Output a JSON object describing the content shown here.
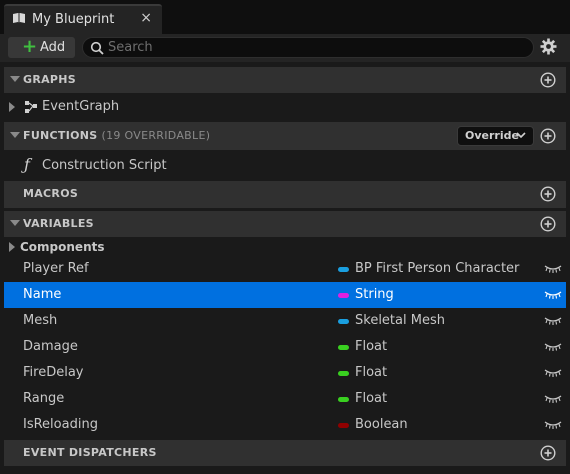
{
  "tab": {
    "title": "My Blueprint",
    "close": "×"
  },
  "toolbar": {
    "add_label": "Add",
    "search_placeholder": "Search"
  },
  "graphs": {
    "title": "GRAPHS",
    "items": [
      {
        "label": "EventGraph"
      }
    ]
  },
  "functions": {
    "title": "FUNCTIONS",
    "subtitle": "(19 OVERRIDABLE)",
    "override_label": "Override",
    "items": [
      {
        "label": "Construction Script"
      }
    ]
  },
  "macros": {
    "title": "MACROS"
  },
  "variables": {
    "title": "VARIABLES",
    "category": "Components",
    "items": [
      {
        "name": "Player Ref",
        "type": "BP First Person Character",
        "color": "#1a9fe0",
        "selected": false
      },
      {
        "name": "Name",
        "type": "String",
        "color": "#e020e0",
        "selected": true
      },
      {
        "name": "Mesh",
        "type": "Skeletal Mesh",
        "color": "#1a9fe0",
        "selected": false
      },
      {
        "name": "Damage",
        "type": "Float",
        "color": "#39d020",
        "selected": false
      },
      {
        "name": "FireDelay",
        "type": "Float",
        "color": "#39d020",
        "selected": false
      },
      {
        "name": "Range",
        "type": "Float",
        "color": "#39d020",
        "selected": false
      },
      {
        "name": "IsReloading",
        "type": "Boolean",
        "color": "#900000",
        "selected": false
      }
    ]
  },
  "event_dispatchers": {
    "title": "EVENT DISPATCHERS"
  }
}
